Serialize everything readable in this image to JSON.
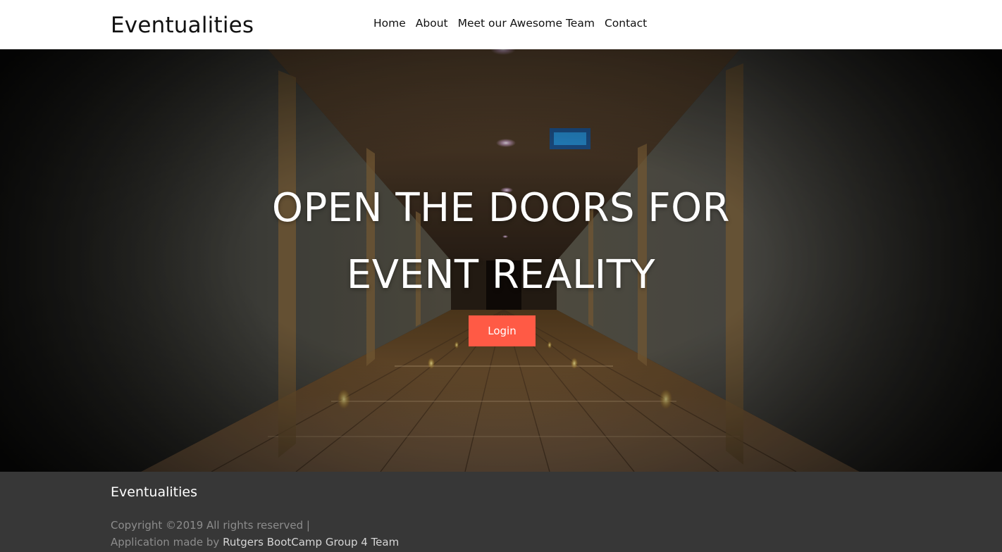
{
  "navbar": {
    "brand": "Eventualities",
    "links": [
      {
        "label": "Home"
      },
      {
        "label": "About"
      },
      {
        "label": "Meet our Awesome Team"
      },
      {
        "label": "Contact"
      }
    ]
  },
  "hero": {
    "title_line1": "OPEN THE DOORS FOR",
    "title_line2": "EVENT REALITY",
    "login_label": "Login",
    "background_image": "hotel-corridor-photo"
  },
  "footer": {
    "brand": "Eventualities",
    "copyright": "Copyright ©2019 All rights reserved |",
    "made_by_prefix": "Application made by",
    "made_by_team": "Rutgers BootCamp Group 4 Team"
  },
  "colors": {
    "accent": "#ff5a45",
    "footer_bg": "#373737",
    "nav_bg": "#ffffff",
    "text_dark": "#111111"
  }
}
